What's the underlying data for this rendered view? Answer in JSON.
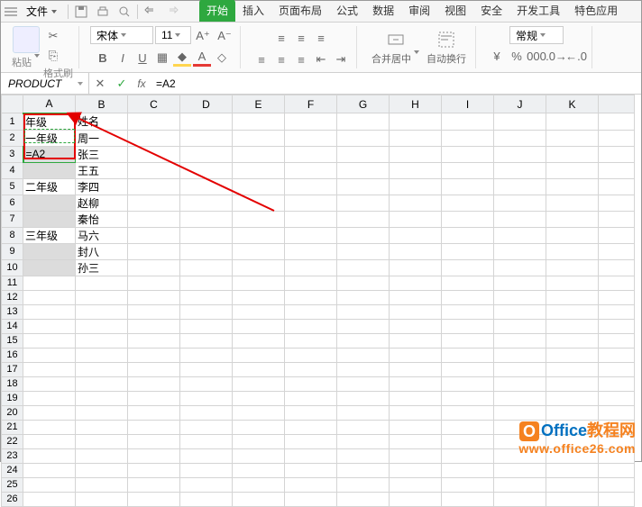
{
  "menu": {
    "file": "文件"
  },
  "tabs": [
    "开始",
    "插入",
    "页面布局",
    "公式",
    "数据",
    "审阅",
    "视图",
    "安全",
    "开发工具",
    "特色应用"
  ],
  "activeTab": 0,
  "ribbon": {
    "paste": "粘贴",
    "fmtPainter": "格式刷",
    "fontName": "宋体",
    "fontSize": "11",
    "merge": "合并居中",
    "wrap": "自动换行",
    "numFmt": "常规"
  },
  "nameBox": "PRODUCT",
  "formula": "=A2",
  "columns": [
    "A",
    "B",
    "C",
    "D",
    "E",
    "F",
    "G",
    "H",
    "I",
    "J",
    "K"
  ],
  "rowCount": 26,
  "cells": {
    "A1": "年级",
    "B1": "姓名",
    "A2": "一年级",
    "B2": "周一",
    "A3": "=A2",
    "B3": "张三",
    "B4": "王五",
    "A5": "二年级",
    "B5": "李四",
    "B6": "赵柳",
    "B7": "秦怡",
    "A8": "三年级",
    "B8": "马六",
    "B9": "封八",
    "B10": "孙三"
  },
  "watermark": {
    "brand1": "Office",
    "brand2": "教程网",
    "url": "www.office26.com"
  }
}
